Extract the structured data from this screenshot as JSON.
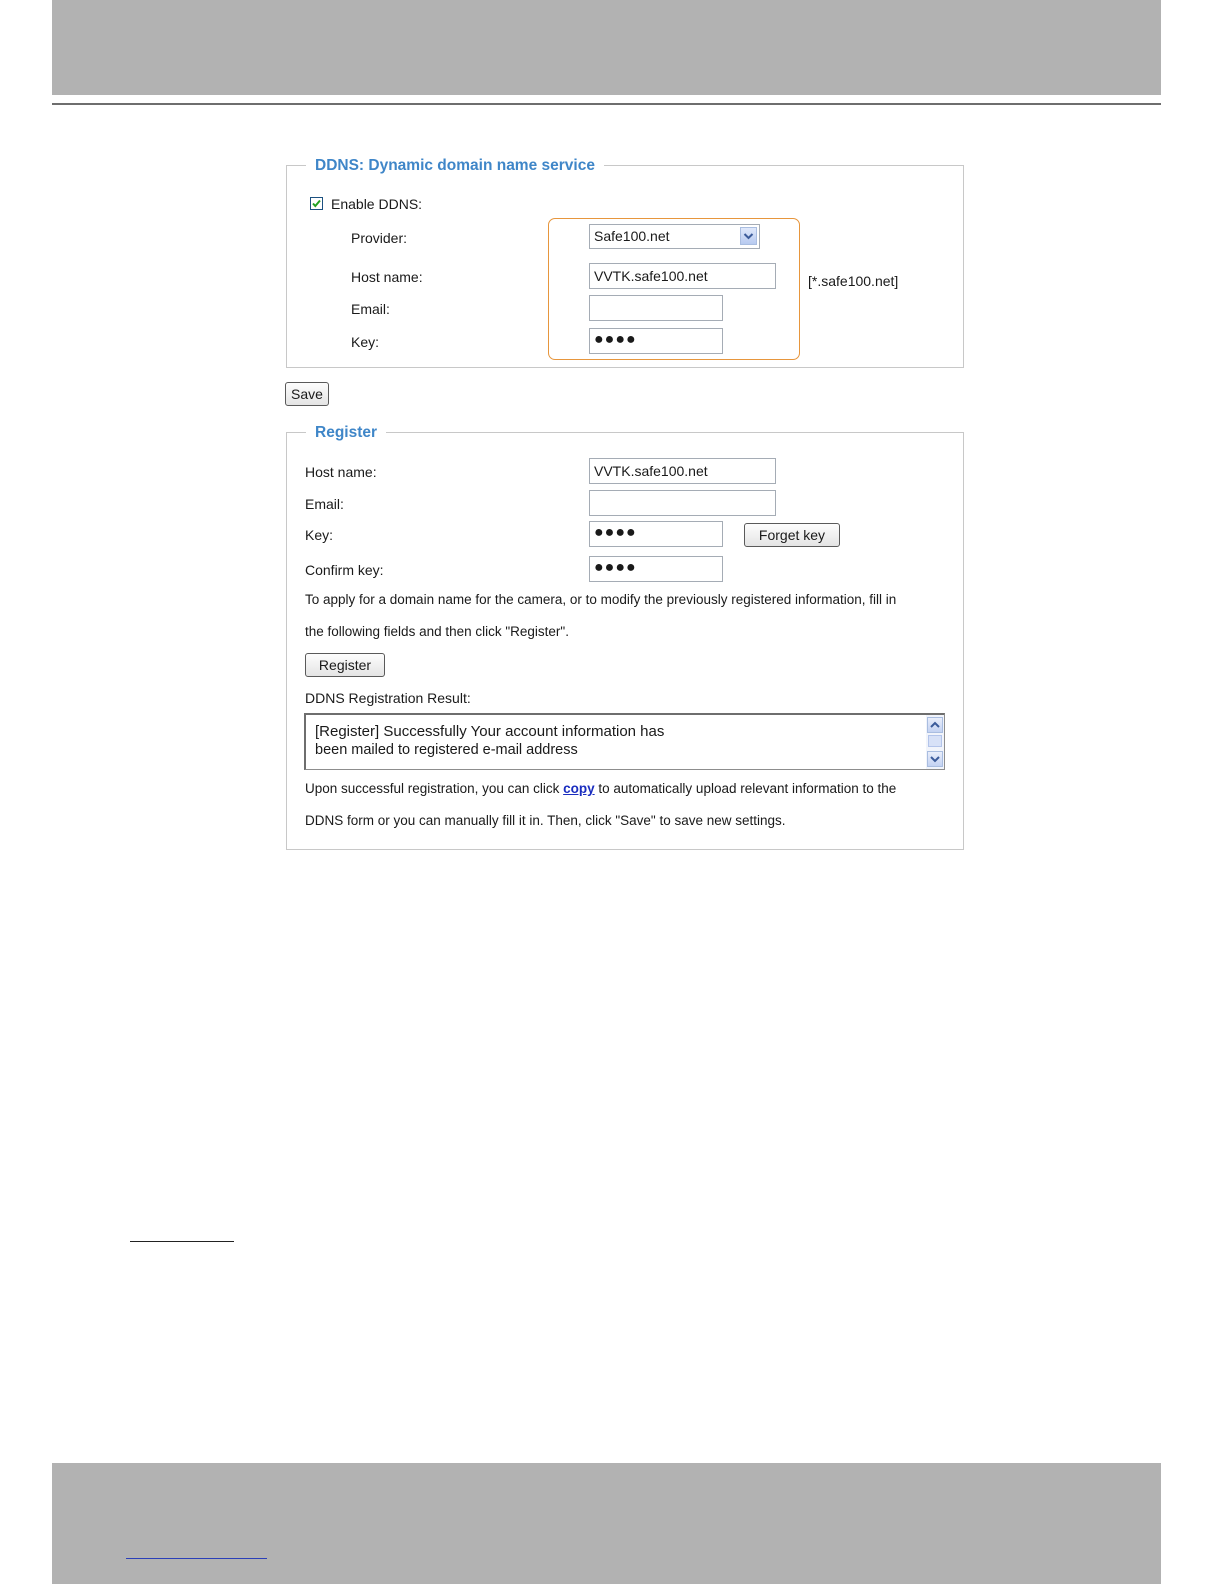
{
  "ddns": {
    "legend": "DDNS: Dynamic domain name service",
    "enable_label": "Enable DDNS:",
    "enabled": true,
    "provider_label": "Provider:",
    "provider_value": "Safe100.net",
    "host_label": "Host name:",
    "host_value": "VVTK.safe100.net",
    "host_hint": "[*.safe100.net]",
    "email_label": "Email:",
    "email_value": "",
    "key_label": "Key:",
    "key_value": "●●●●",
    "save_label": "Save"
  },
  "register": {
    "legend": "Register",
    "host_label": "Host name:",
    "host_value": "VVTK.safe100.net",
    "email_label": "Email:",
    "email_value": "",
    "key_label": "Key:",
    "key_value": "●●●●",
    "forget_key_label": "Forget key",
    "confirm_key_label": "Confirm key:",
    "confirm_key_value": "●●●●",
    "instruction_line1": "To apply for a domain name for the camera, or to modify the previously registered information, fill in",
    "instruction_line2": "the following fields and then click \"Register\".",
    "register_label": "Register",
    "result_label": "DDNS Registration Result:",
    "result_line1": "[Register] Successfully  Your account information has",
    "result_line2": "been mailed to registered e-mail address",
    "note_before": "Upon successful registration, you can click ",
    "note_link": "copy",
    "note_after": " to automatically upload relevant information to the",
    "note_line2": "DDNS form or you can manually fill it in. Then, click \"Save\" to save new settings."
  },
  "colors": {
    "legend": "#3f86c8",
    "highlight": "#e7963d",
    "band": "#b2b2b2",
    "link": "#1a2dbf"
  },
  "icons": {
    "checkbox": "check-icon",
    "select": "chevron-down-icon",
    "scroll_up": "chevron-up-icon",
    "scroll_down": "chevron-down-icon"
  }
}
